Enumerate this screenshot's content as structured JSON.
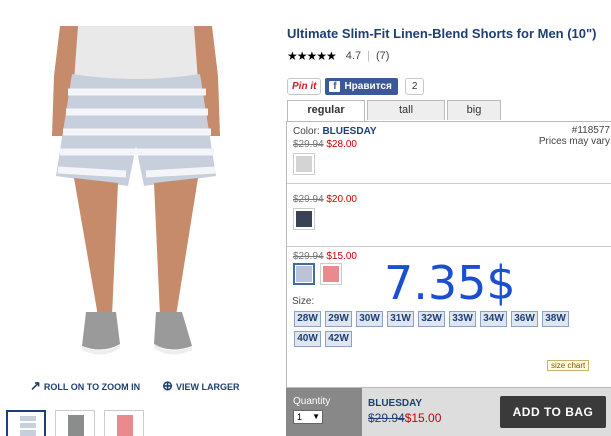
{
  "product": {
    "title": "Ultimate Slim-Fit Linen-Blend Shorts for Men (10\")",
    "rating_stars": "★★★★★",
    "rating_value": "4.7",
    "review_count": "(7)"
  },
  "social": {
    "pinit_label": "Pin it",
    "fb_label": "Нравится",
    "fb_icon": "f",
    "fb_count": "2"
  },
  "tabs": [
    {
      "label": "regular",
      "active": true
    },
    {
      "label": "tall",
      "active": false
    },
    {
      "label": "big",
      "active": false
    }
  ],
  "image_actions": {
    "zoom": "ROLL ON TO ZOOM IN",
    "larger": "VIEW LARGER"
  },
  "color_groups": [
    {
      "color_prefix": "Color: ",
      "color_name": "BLUESDAY",
      "item_number": "#118577",
      "item_note": "Prices may vary",
      "old_price": "$29.94",
      "new_price": "$28.00",
      "swatches": [
        {
          "color": "#d4d4d4",
          "selected": false
        }
      ]
    },
    {
      "old_price": "$29.94",
      "new_price": "$20.00",
      "swatches": [
        {
          "color": "#3c4256",
          "selected": false
        }
      ]
    },
    {
      "old_price": "$29.94",
      "new_price": "$15.00",
      "swatches": [
        {
          "color": "#b9c4d8",
          "selected": true
        },
        {
          "color": "#e88a8e",
          "selected": false
        }
      ]
    }
  ],
  "overlay_price": "7.35$",
  "size": {
    "label": "Size:",
    "options": [
      "28W",
      "29W",
      "30W",
      "31W",
      "32W",
      "33W",
      "34W",
      "36W",
      "38W",
      "40W",
      "42W"
    ],
    "chart_label": "size chart"
  },
  "purchase": {
    "quantity_label": "Quantity",
    "quantity_value": "1",
    "selected_color": "BLUESDAY",
    "old_price": "$29.94",
    "new_price": "$15.00",
    "add_to_bag": "ADD TO BAG"
  },
  "thumbnails": [
    {
      "name": "thumbnail-blue-stripe",
      "selected": true
    },
    {
      "name": "thumbnail-gray",
      "selected": false
    },
    {
      "name": "thumbnail-pink",
      "selected": false
    }
  ]
}
